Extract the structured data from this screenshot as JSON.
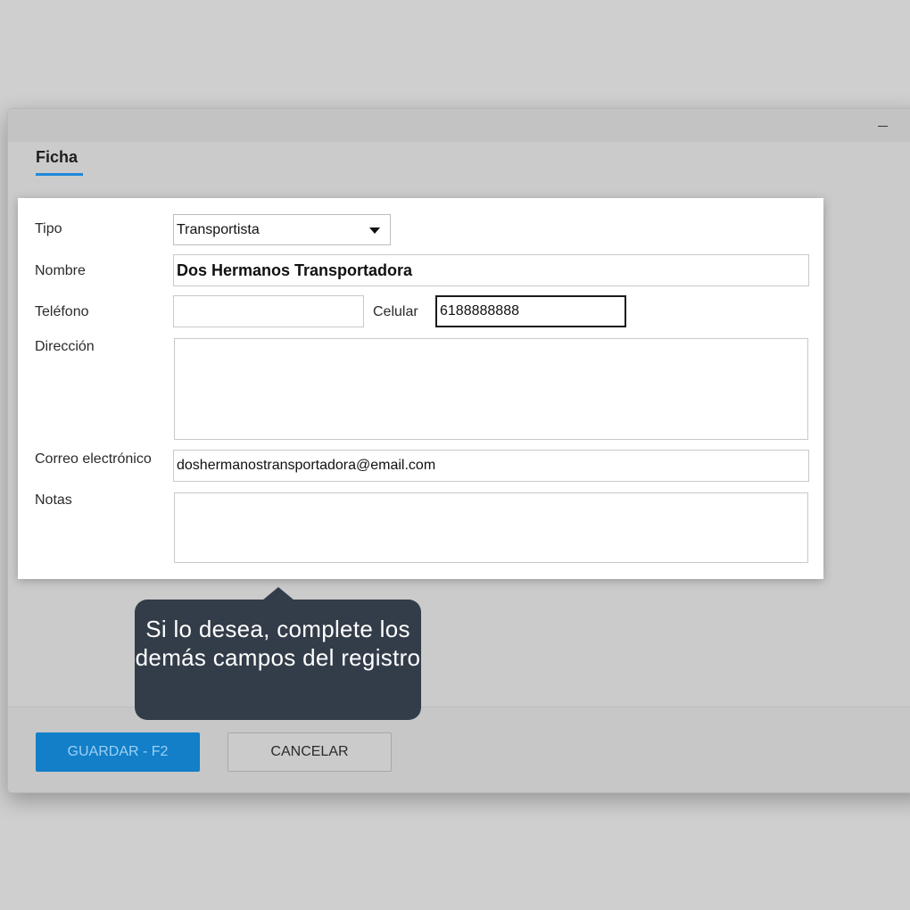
{
  "dialog": {
    "tab_label": "Ficha",
    "minimize_label": "–"
  },
  "form": {
    "tipo": {
      "label": "Tipo",
      "value": "Transportista"
    },
    "nombre": {
      "label": "Nombre",
      "value": "Dos Hermanos Transportadora"
    },
    "telefono": {
      "label": "Teléfono",
      "value": ""
    },
    "celular": {
      "label": "Celular",
      "value": "6188888888"
    },
    "direccion": {
      "label": "Dirección",
      "value": ""
    },
    "correo": {
      "label": "Correo electrónico",
      "value": "doshermanostransportadora@email.com"
    },
    "notas": {
      "label": "Notas",
      "value": ""
    }
  },
  "footer": {
    "save_label": "GUARDAR - F2",
    "cancel_label": "CANCELAR"
  },
  "tooltip": {
    "text": "Si lo desea, complete los demás campos del registro"
  },
  "colors": {
    "accent": "#127fc8",
    "tooltip_bg": "#333d49"
  }
}
